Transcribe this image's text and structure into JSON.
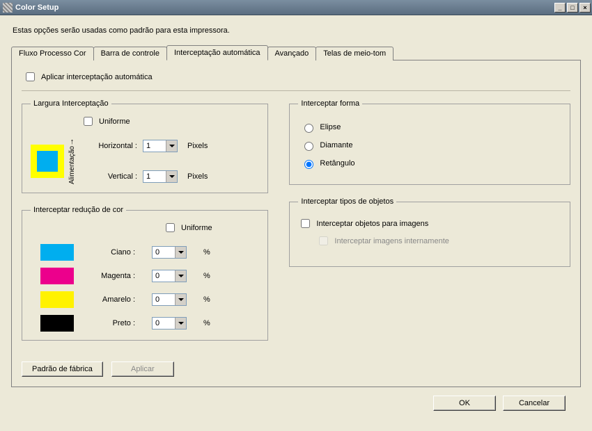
{
  "window": {
    "title": "Color Setup"
  },
  "description": "Estas opções serão usadas como padrão para esta impressora.",
  "tabs": {
    "flow": "Fluxo Processo Cor",
    "control_bar": "Barra de controle",
    "auto_trap": "Interceptação automática",
    "advanced": "Avançado",
    "halftone": "Telas de meio-tom"
  },
  "apply_trap": {
    "label": "Aplicar interceptação automática",
    "checked": false
  },
  "width_group": {
    "legend": "Largura Interceptação",
    "feed_label": "Alimentação",
    "uniform_label": "Uniforme",
    "uniform_checked": false,
    "horizontal_label": "Horizontal :",
    "horizontal_value": "1",
    "vertical_label": "Vertical :",
    "vertical_value": "1",
    "unit": "Pixels"
  },
  "shape_group": {
    "legend": "Interceptar forma",
    "options": {
      "ellipse": "Elipse",
      "diamond": "Diamante",
      "rectangle": "Retângulo"
    },
    "selected": "rectangle"
  },
  "reduction_group": {
    "legend": "Interceptar redução de cor",
    "uniform_label": "Uniforme",
    "uniform_checked": false,
    "rows": {
      "cyan": {
        "label": "Ciano :",
        "value": "0",
        "unit": "%"
      },
      "magenta": {
        "label": "Magenta :",
        "value": "0",
        "unit": "%"
      },
      "yellow": {
        "label": "Amarelo :",
        "value": "0",
        "unit": "%"
      },
      "black": {
        "label": "Preto :",
        "value": "0",
        "unit": "%"
      }
    }
  },
  "objects_group": {
    "legend": "Interceptar tipos de objetos",
    "trap_images_label": "Interceptar objetos para imagens",
    "trap_images_checked": false,
    "trap_internal_label": "Interceptar imagens internamente",
    "trap_internal_checked": false,
    "trap_internal_disabled": true
  },
  "buttons": {
    "factory": "Padrão de fábrica",
    "apply": "Aplicar",
    "ok": "OK",
    "cancel": "Cancelar"
  }
}
